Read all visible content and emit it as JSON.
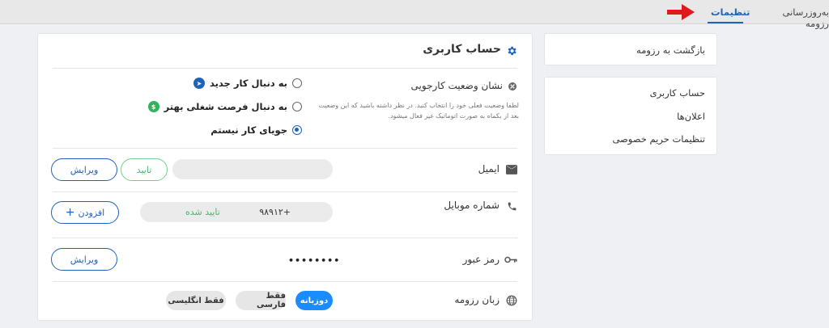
{
  "topnav": {
    "tab_settings": "تنظیمات",
    "tab_update": "به‌روزرسانی رزومه"
  },
  "sidebar": {
    "back": "بازگشت به رزومه",
    "items": [
      "حساب کاربری",
      "اعلان‌ها",
      "تنظیمات حریم خصوصی"
    ]
  },
  "account": {
    "title": "حساب کاربری",
    "status": {
      "label": "نشان وضعیت کارجویی",
      "hint": "لطفا وضعیت فعلی خود را انتخاب کنید. در نظر داشته باشید که این وضعیت بعد از یکماه به صورت اتوماتیک غیر فعال میشود.",
      "options": [
        "به دنبال کار جدید",
        "به دنبال فرصت شغلی بهتر",
        "جویای کار نیستم"
      ],
      "selected": "جویای کار نیستم"
    },
    "email": {
      "label": "ایمیل",
      "verify_button": "تایید",
      "edit_button": "ویرایش"
    },
    "mobile": {
      "label": "شماره موبایل",
      "value": "+۹۸۹۱۲",
      "status": "تایید شده",
      "add_button": "افزودن"
    },
    "password": {
      "label": "رمز عبور",
      "masked": "••••••••",
      "edit_button": "ویرایش"
    },
    "language": {
      "label": "زبان رزومه",
      "options": [
        "دوزبانه",
        "فقط فارسی",
        "فقط انگلیسی"
      ],
      "selected": "دوزبانه"
    }
  },
  "colors": {
    "primary": "#1e63b8",
    "accent_chip": "#1a8cff",
    "success": "#4ab56f",
    "arrow": "#e0191b"
  }
}
